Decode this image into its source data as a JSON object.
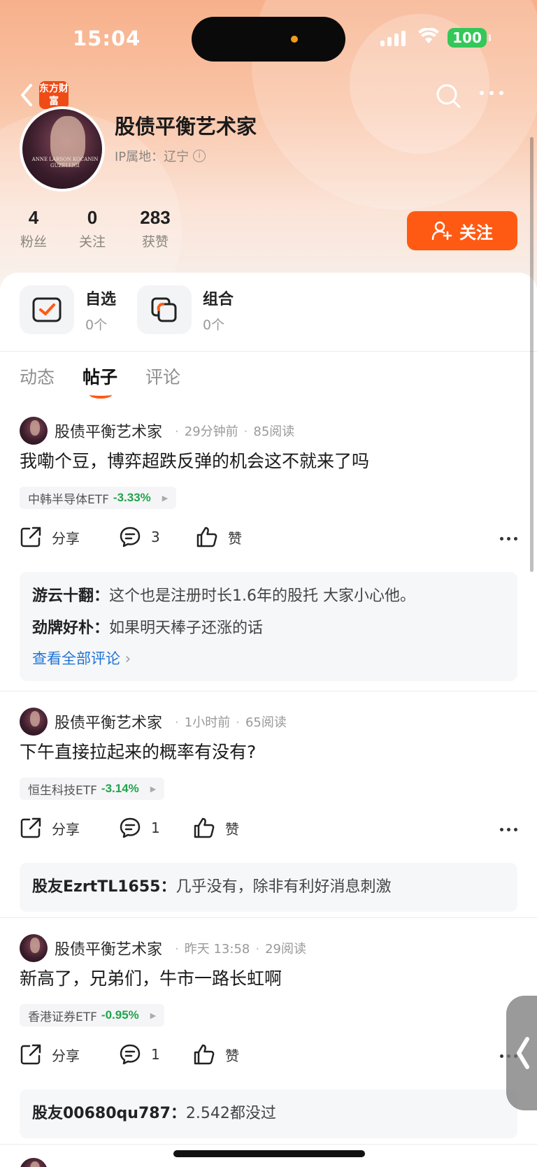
{
  "status_bar": {
    "time": "15:04",
    "battery": "100"
  },
  "header": {
    "brand_badge": "东方财富",
    "username": "股债平衡艺术家",
    "ip_location": "IP属地：辽宁",
    "avatar_text": "ANNE LARSON KOCANIN GUZELLIGI"
  },
  "stats": [
    {
      "value": "4",
      "label": "粉丝"
    },
    {
      "value": "0",
      "label": "关注"
    },
    {
      "value": "283",
      "label": "获赞"
    }
  ],
  "follow_button": "关注",
  "tools": [
    {
      "title": "自选",
      "count": "0个",
      "icon": "checkbox-icon"
    },
    {
      "title": "组合",
      "count": "0个",
      "icon": "portfolio-icon"
    }
  ],
  "tabs": [
    {
      "label": "动态",
      "active": false
    },
    {
      "label": "帖子",
      "active": true
    },
    {
      "label": "评论",
      "active": false
    }
  ],
  "posts": [
    {
      "author": "股债平衡艺术家",
      "time": "29分钟前",
      "reads": "85阅读",
      "text": "我嘞个豆，博弈超跌反弹的机会这不就来了吗",
      "tag_name": "中韩半导体ETF",
      "tag_change": "-3.33%",
      "share": "分享",
      "comments": "3",
      "like": "赞",
      "comment_list": [
        {
          "name": "游云十翻：",
          "text": "这个也是注册时长1.6年的股托 大家小心他。"
        },
        {
          "name": "劲牌好朴：",
          "text": "如果明天棒子还涨的话"
        }
      ],
      "view_all": "查看全部评论"
    },
    {
      "author": "股债平衡艺术家",
      "time": "1小时前",
      "reads": "65阅读",
      "text": "下午直接拉起来的概率有没有?",
      "tag_name": "恒生科技ETF",
      "tag_change": "-3.14%",
      "share": "分享",
      "comments": "1",
      "like": "赞",
      "comment_list": [
        {
          "name": "股友EzrtTL1655：",
          "text": "几乎没有，除非有利好消息刺激"
        }
      ]
    },
    {
      "author": "股债平衡艺术家",
      "time": "昨天 13:58",
      "reads": "29阅读",
      "text": "新高了，兄弟们，牛市一路长虹啊",
      "tag_name": "香港证券ETF",
      "tag_change": "-0.95%",
      "share": "分享",
      "comments": "1",
      "like": "赞",
      "comment_list": [
        {
          "name": "股友00680qu787：",
          "text": "2.542都没过"
        }
      ]
    }
  ],
  "colors": {
    "accent": "#ff5a14",
    "down": "#1fa54b",
    "link": "#1f74d6"
  }
}
